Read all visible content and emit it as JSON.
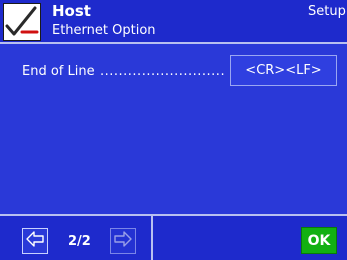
{
  "header": {
    "title": "Host",
    "subtitle": "Ethernet Option",
    "mode_label": "Setup",
    "icon": "checkmark-icon"
  },
  "settings": {
    "rows": [
      {
        "label": "End of Line",
        "dots": "...........................",
        "value": "<CR><LF>"
      }
    ]
  },
  "footer": {
    "prev_icon": "arrow-left-icon",
    "next_icon": "arrow-right-icon",
    "page_counter": "2/2",
    "ok_label": "OK"
  },
  "colors": {
    "background": "#2a39d8",
    "header": "#1e2acc",
    "ok_button": "#12b012",
    "check_red": "#d01010",
    "check_green": "#12b012"
  }
}
